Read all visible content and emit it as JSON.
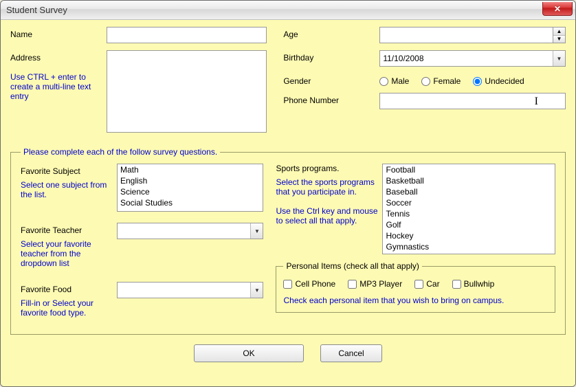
{
  "window": {
    "title": "Student Survey"
  },
  "top": {
    "name_label": "Name",
    "address_label": "Address",
    "address_hint": "Use CTRL + enter to create a multi-line text entry",
    "age_label": "Age",
    "birthday_label": "Birthday",
    "birthday_value": "11/10/2008",
    "gender_label": "Gender",
    "gender_options": {
      "male": "Male",
      "female": "Female",
      "undecided": "Undecided"
    },
    "gender_selected": "undecided",
    "phone_label": "Phone Number"
  },
  "survey": {
    "legend": "Please complete each of the follow survey questions.",
    "favorite_subject": {
      "label": "Favorite Subject",
      "hint": "Select one subject from the list.",
      "items": [
        "Math",
        "English",
        "Science",
        "Social Studies"
      ]
    },
    "favorite_teacher": {
      "label": "Favorite Teacher",
      "hint": "Select your favorite teacher from the dropdown list"
    },
    "favorite_food": {
      "label": "Favorite Food",
      "hint": "Fill-in or Select your favorite food type."
    },
    "sports": {
      "label": "Sports programs.",
      "hint1": "Select the sports programs that you participate in.",
      "hint2": "Use the Ctrl key and mouse to select all that apply.",
      "items": [
        "Football",
        "Basketball",
        "Baseball",
        "Soccer",
        "Tennis",
        "Golf",
        "Hockey",
        "Gymnastics"
      ]
    },
    "personal": {
      "legend": "Personal Items (check all that apply)",
      "items": {
        "cell": "Cell Phone",
        "mp3": "MP3 Player",
        "car": "Car",
        "whip": "Bullwhip"
      },
      "hint": "Check each personal item that you wish to bring on campus."
    }
  },
  "buttons": {
    "ok": "OK",
    "cancel": "Cancel"
  }
}
